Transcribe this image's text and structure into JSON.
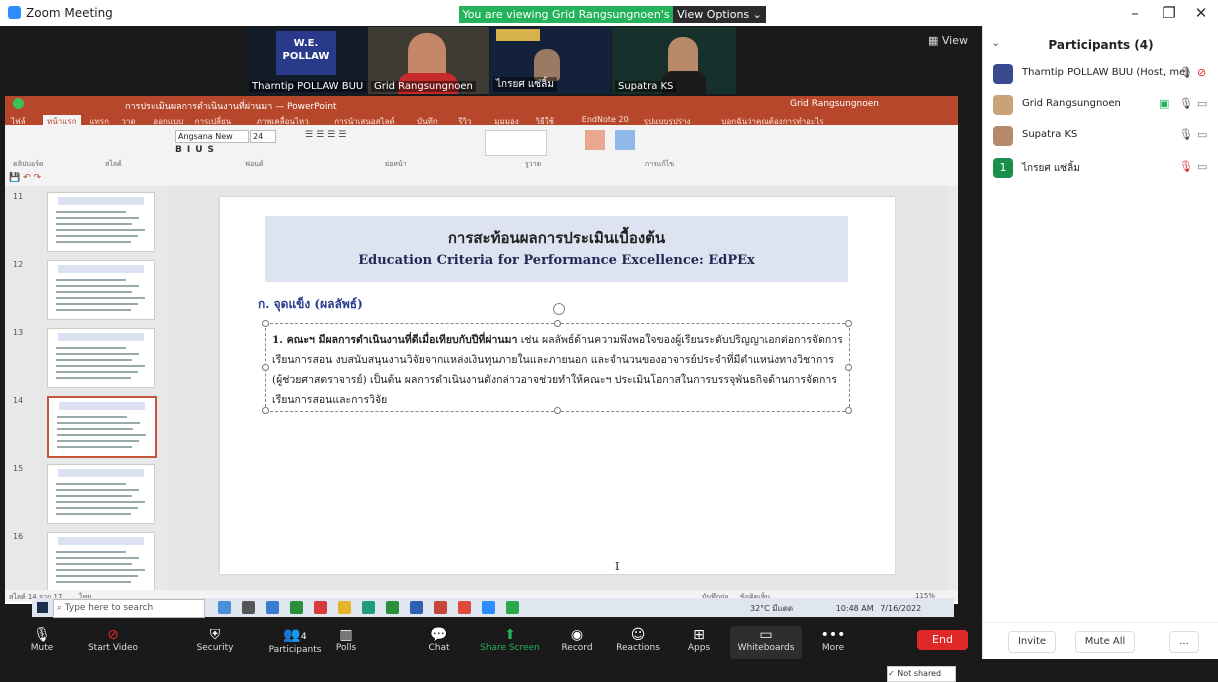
{
  "titlebar": {
    "title": "Zoom Meeting",
    "banner": "You are viewing Grid Rangsungnoen's screen",
    "view_options": "View Options ⌄",
    "min": "–",
    "restore": "❐",
    "close": "✕"
  },
  "videos": {
    "view_label": "View",
    "tiles": [
      {
        "name": "Tharntip POLLAW BUU",
        "caption": "W.E.\nPOLLAW"
      },
      {
        "name": "Grid Rangsungnoen"
      },
      {
        "name": "ไกรยศ แซ่ลิ้ม"
      },
      {
        "name": "Supatra KS"
      }
    ]
  },
  "ppt": {
    "window_title": "การประเมินผลการดำเนินงานที่ผ่านมา — PowerPoint",
    "account": "Grid Rangsungnoen",
    "tabs": [
      "ไฟล์",
      "หน้าแรก",
      "แทรก",
      "วาด",
      "ออกแบบ",
      "การเปลี่ยน",
      "ภาพเคลื่อนไหว",
      "การนำเสนอสไลด์",
      "บันทึก",
      "รีวิว",
      "มุมมอง",
      "วิธีใช้",
      "EndNote 20",
      "รูปแบบรูปร่าง",
      "บอกฉันว่าคุณต้องการทำอะไร"
    ],
    "font_name": "Angsana New",
    "font_size": "24",
    "ribbon_groups": [
      "คลิปบอร์ด",
      "สไลด์",
      "ฟอนต์",
      "ย่อหน้า",
      "รูวาด",
      "การแก้ไข"
    ],
    "slide_numbers": [
      "11",
      "12",
      "13",
      "14",
      "15",
      "16"
    ],
    "selected_slide": "14",
    "status_left": "สไลด์ 14 จาก 17",
    "status_lang": "ไทย",
    "status_notes": "บันทึกย่อ",
    "status_comments": "ข้อคิดเห็น",
    "zoom": "115%",
    "not_shared": "✓ Not shared"
  },
  "slide": {
    "thai_title": "การสะท้อนผลการประเมินเบื้องต้น",
    "en_title": "Education Criteria for Performance Excellence: EdPEx",
    "subheading": "ก. จุดแข็ง (ผลลัพธ์)",
    "body_bold": "1. คณะฯ  มีผลการดำเนินงานที่ดีเมื่อเทียบกับปีที่ผ่านมา",
    "body_rest": " เช่น ผลลัพธ์ด้านความพึงพอใจของผู้เรียนระดับปริญญาเอกต่อการจัดการเรียนการสอน งบสนับสนุนงานวิจัยจากแหล่งเงินทุนภายในและภายนอก และจำนวนของอาจารย์ประจำที่มีตำแหน่งทางวิชาการ (ผู้ช่วยศาสตราจารย์) เป็นต้น ผลการดำเนินงานดังกล่าวอาจช่วยทำให้คณะฯ ประเมินโอกาสในการบรรจุพันธกิจด้านการจัดการเรียนการสอนและการวิจัย",
    "cursor": "I"
  },
  "taskbar": {
    "search_placeholder": "Type here to search",
    "weather": "32°C มีแดด",
    "time": "10:48 AM",
    "date": "7/16/2022"
  },
  "participants": {
    "title": "Participants (4)",
    "list": [
      {
        "name": "Tharntip POLLAW BUU (Host, me)",
        "color": "#3b4a8f"
      },
      {
        "name": "Grid Rangsungnoen",
        "color": "#c9a27a"
      },
      {
        "name": "Supatra KS",
        "color": "#b88a6c"
      },
      {
        "name": "ไกรยศ แซ่ลิ้ม",
        "initial": "1",
        "color": "#1a8f4a"
      }
    ],
    "invite": "Invite",
    "mute_all": "Mute All",
    "more": "..."
  },
  "toolbar": {
    "mute": "Mute",
    "start_video": "Start Video",
    "security": "Security",
    "participants": "Participants",
    "participants_count": "4",
    "polls": "Polls",
    "chat": "Chat",
    "share_screen": "Share Screen",
    "record": "Record",
    "reactions": "Reactions",
    "apps": "Apps",
    "whiteboards": "Whiteboards",
    "more": "More",
    "end": "End"
  }
}
